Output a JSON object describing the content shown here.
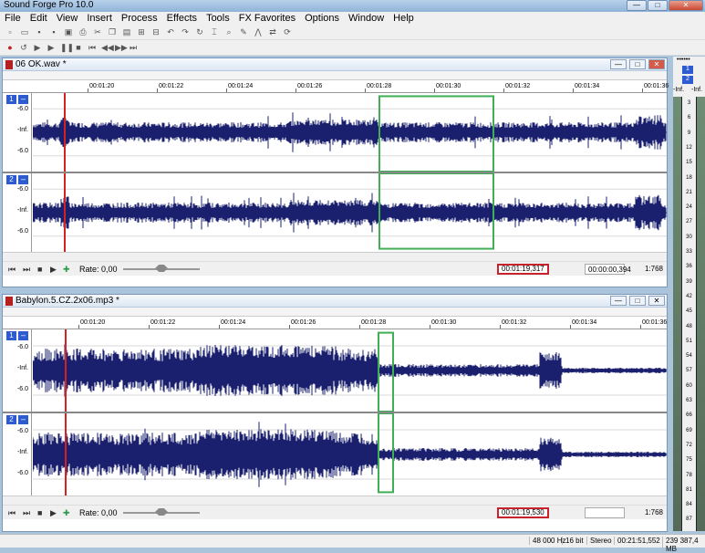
{
  "app": {
    "title": "Sound Forge Pro 10.0"
  },
  "window_buttons": {
    "minimize": "—",
    "maximize": "□",
    "close": "✕"
  },
  "menu": [
    "File",
    "Edit",
    "View",
    "Insert",
    "Process",
    "Effects",
    "Tools",
    "FX Favorites",
    "Options",
    "Window",
    "Help"
  ],
  "toolbar1_icons": [
    "new-icon",
    "open-icon",
    "save-icon",
    "save-as-icon",
    "render-icon",
    "print-icon",
    "cut-icon",
    "copy-icon",
    "paste-icon",
    "mix-icon",
    "trim-icon",
    "undo-icon",
    "redo-icon",
    "repeat-icon",
    "edit-tool-icon",
    "magnify-tool-icon",
    "pencil-tool-icon",
    "envelope-tool-icon",
    "event-tool-icon",
    "scrub-icon"
  ],
  "toolbar2_icons": [
    "record-icon",
    "loop-icon",
    "play-all-icon",
    "play-icon",
    "pause-icon",
    "stop-icon",
    "go-to-start-icon",
    "rewind-icon",
    "fast-forward-icon",
    "go-to-end-icon"
  ],
  "ruler_ticks": [
    "00:01:20",
    "00:01:22",
    "00:01:24",
    "00:01:26",
    "00:01:28",
    "00:01:30",
    "00:01:32",
    "00:01:34",
    "00:01:36"
  ],
  "windows": [
    {
      "filename": "06 OK.wav *",
      "channels": [
        {
          "number": "1",
          "minus": "–",
          "scale": [
            "-6.0",
            "-Inf.",
            "-6.0"
          ]
        },
        {
          "number": "2",
          "minus": "–",
          "scale": [
            "-6.0",
            "-Inf.",
            "-6.0"
          ]
        }
      ],
      "rate_label": "Rate: 0,00",
      "cursor_time": "00:01:19,317",
      "selection_length": "00:00:00,394",
      "zoom": "1:768",
      "transport_plus": "+",
      "transport_minus": "−"
    },
    {
      "filename": "Babylon.5.CZ.2x06.mp3 *",
      "channels": [
        {
          "number": "1",
          "minus": "–",
          "scale": [
            "-6.0",
            "-Inf.",
            "-6.0"
          ]
        },
        {
          "number": "2",
          "minus": "–",
          "scale": [
            "-6.0",
            "-Inf.",
            "-6.0"
          ]
        }
      ],
      "rate_label": "Rate: 0,00",
      "cursor_time": "00:01:19,530",
      "selection_length": "",
      "zoom": "1:768",
      "transport_plus": "+",
      "transport_minus": "−"
    }
  ],
  "meters": {
    "header_dots": "••••••",
    "ch1": "1",
    "ch2": "2",
    "inf_left": "-Inf.",
    "inf_right": "-Inf.",
    "scale": [
      "3",
      "6",
      "9",
      "12",
      "15",
      "18",
      "21",
      "24",
      "27",
      "30",
      "33",
      "36",
      "39",
      "42",
      "45",
      "48",
      "51",
      "54",
      "57",
      "60",
      "63",
      "66",
      "69",
      "72",
      "75",
      "78",
      "81",
      "84",
      "87"
    ]
  },
  "status": {
    "sample_rate": "48 000 Hz",
    "bit_depth": "16 bit",
    "channels": "Stereo",
    "length": "00:21:51,552",
    "disk_space": "239 387,4 MB"
  },
  "colors": {
    "waveform": "#1a1f6e",
    "selection_box": "#3fae55",
    "cursor_line": "#d42222",
    "time_highlight": "#c8232d",
    "channel_badge": "#2d5bd1"
  }
}
